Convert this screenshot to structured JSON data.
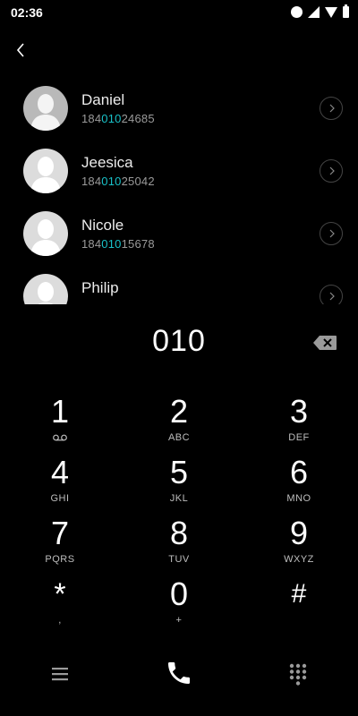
{
  "status_bar": {
    "time": "02:36",
    "icons": [
      "notification-dots-icon",
      "cell-signal-icon",
      "wifi-icon",
      "battery-icon"
    ]
  },
  "nav": {
    "back_icon": "back-chevron-icon"
  },
  "contacts": [
    {
      "name": "Daniel",
      "number_prefix": "184",
      "number_match": "010",
      "number_suffix": "24685"
    },
    {
      "name": "Jeesica",
      "number_prefix": "184",
      "number_match": "010",
      "number_suffix": "25042"
    },
    {
      "name": "Nicole",
      "number_prefix": "184",
      "number_match": "010",
      "number_suffix": "15678"
    },
    {
      "name": "Philip",
      "number_prefix": "",
      "number_match": "",
      "number_suffix": ""
    }
  ],
  "dial": {
    "input": "010",
    "backspace_icon": "backspace-icon"
  },
  "keypad": [
    {
      "digit": "1",
      "letters": ""
    },
    {
      "digit": "2",
      "letters": "ABC"
    },
    {
      "digit": "3",
      "letters": "DEF"
    },
    {
      "digit": "4",
      "letters": "GHI"
    },
    {
      "digit": "5",
      "letters": "JKL"
    },
    {
      "digit": "6",
      "letters": "MNO"
    },
    {
      "digit": "7",
      "letters": "PQRS"
    },
    {
      "digit": "8",
      "letters": "TUV"
    },
    {
      "digit": "9",
      "letters": "WXYZ"
    },
    {
      "digit": "*",
      "letters": ","
    },
    {
      "digit": "0",
      "letters": "+"
    },
    {
      "digit": "#",
      "letters": ""
    }
  ],
  "bottom_bar": {
    "icons": [
      "menu-icon",
      "phone-call-icon",
      "dialpad-icon"
    ]
  },
  "colors": {
    "background": "#000000",
    "match_highlight": "#19c1c8",
    "secondary_text": "#9a9a9a"
  }
}
